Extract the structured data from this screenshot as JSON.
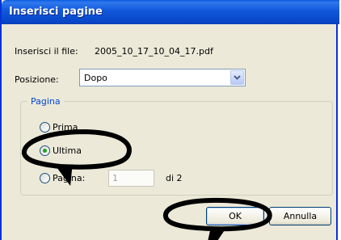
{
  "window": {
    "title": "Inserisci pagine"
  },
  "file": {
    "label": "Inserisci il file:",
    "name": "2005_10_17_10_04_17.pdf"
  },
  "position": {
    "label": "Posizione:",
    "selected": "Dopo"
  },
  "page_group": {
    "legend": "Pagina",
    "options": [
      {
        "label": "Prima",
        "checked": false
      },
      {
        "label": "Ultima",
        "checked": true
      },
      {
        "label": "Pagina:",
        "checked": false
      }
    ],
    "page_number": "1",
    "of_total": "di 2"
  },
  "buttons": {
    "ok": "OK",
    "cancel": "Annulla"
  },
  "colors": {
    "titlebar": "#0a5ce0",
    "group_legend": "#0046d5",
    "annotation_ink": "#000000"
  }
}
